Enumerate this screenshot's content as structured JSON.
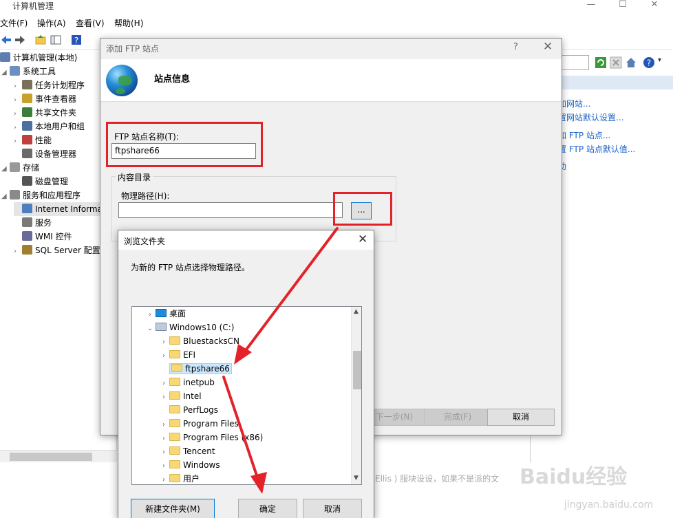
{
  "window": {
    "title": "计算机管理"
  },
  "menu": [
    "文件(F)",
    "操作(A)",
    "查看(V)",
    "帮助(H)"
  ],
  "tree": {
    "root": "计算机管理(本地)",
    "items": [
      {
        "label": "系统工具",
        "level": 1,
        "expanded": true
      },
      {
        "label": "任务计划程序",
        "level": 2
      },
      {
        "label": "事件查看器",
        "level": 2
      },
      {
        "label": "共享文件夹",
        "level": 2
      },
      {
        "label": "本地用户和组",
        "level": 2
      },
      {
        "label": "性能",
        "level": 2
      },
      {
        "label": "设备管理器",
        "level": 2
      },
      {
        "label": "存储",
        "level": 1,
        "expanded": true
      },
      {
        "label": "磁盘管理",
        "level": 2
      },
      {
        "label": "服务和应用程序",
        "level": 1,
        "expanded": true
      },
      {
        "label": "Internet Informa",
        "level": 2,
        "selected": true
      },
      {
        "label": "服务",
        "level": 2
      },
      {
        "label": "WMI 控件",
        "level": 2
      },
      {
        "label": "SQL Server 配置",
        "level": 2
      }
    ]
  },
  "actions": {
    "items": [
      "加网站...",
      "置网站默认设置...",
      "加 FTP 站点...",
      "置 FTP 站点默认值...",
      "助"
    ]
  },
  "wizard": {
    "title": "添加 FTP 站点",
    "help": "?",
    "heading": "站点信息",
    "site_name_label": "FTP 站点名称(T):",
    "site_name_value": "ftpshare66",
    "content_group": "内容目录",
    "path_label": "物理路径(H):",
    "path_value": "",
    "browse_label": "...",
    "buttons": {
      "next": "下一步(N)",
      "finish": "完成(F)",
      "cancel": "取消"
    }
  },
  "browse": {
    "title": "浏览文件夹",
    "description": "为新的 FTP 站点选择物理路径。",
    "tree": [
      {
        "label": "桌面",
        "indent": 0,
        "icon": "desktop",
        "arrow": "right"
      },
      {
        "label": "Windows10 (C:)",
        "indent": 0,
        "icon": "drive",
        "arrow": "down"
      },
      {
        "label": "BluestacksCN",
        "indent": 1,
        "icon": "folder",
        "arrow": "right"
      },
      {
        "label": "EFI",
        "indent": 1,
        "icon": "folder",
        "arrow": "right"
      },
      {
        "label": "ftpshare66",
        "indent": 1,
        "icon": "folder",
        "arrow": "",
        "selected": true
      },
      {
        "label": "inetpub",
        "indent": 1,
        "icon": "folder",
        "arrow": "right"
      },
      {
        "label": "Intel",
        "indent": 1,
        "icon": "folder",
        "arrow": "right"
      },
      {
        "label": "PerfLogs",
        "indent": 1,
        "icon": "folder",
        "arrow": ""
      },
      {
        "label": "Program Files",
        "indent": 1,
        "icon": "folder",
        "arrow": "right"
      },
      {
        "label": "Program Files (x86)",
        "indent": 1,
        "icon": "folder",
        "arrow": "right"
      },
      {
        "label": "Tencent",
        "indent": 1,
        "icon": "folder",
        "arrow": "right"
      },
      {
        "label": "Windows",
        "indent": 1,
        "icon": "folder",
        "arrow": "right"
      },
      {
        "label": "用户",
        "indent": 1,
        "icon": "folder",
        "arrow": "right"
      }
    ],
    "buttons": {
      "new_folder": "新建文件夹(M)",
      "ok": "确定",
      "cancel": "取消"
    }
  },
  "watermark": {
    "logo": "Baidu经验",
    "url": "jingyan.baidu.com"
  },
  "bottom_text": "Ellis ) 服块设设，如果不是派的文",
  "colors": {
    "highlight": "#e3222a",
    "link": "#1a63c7",
    "selection": "#cce8ff"
  }
}
